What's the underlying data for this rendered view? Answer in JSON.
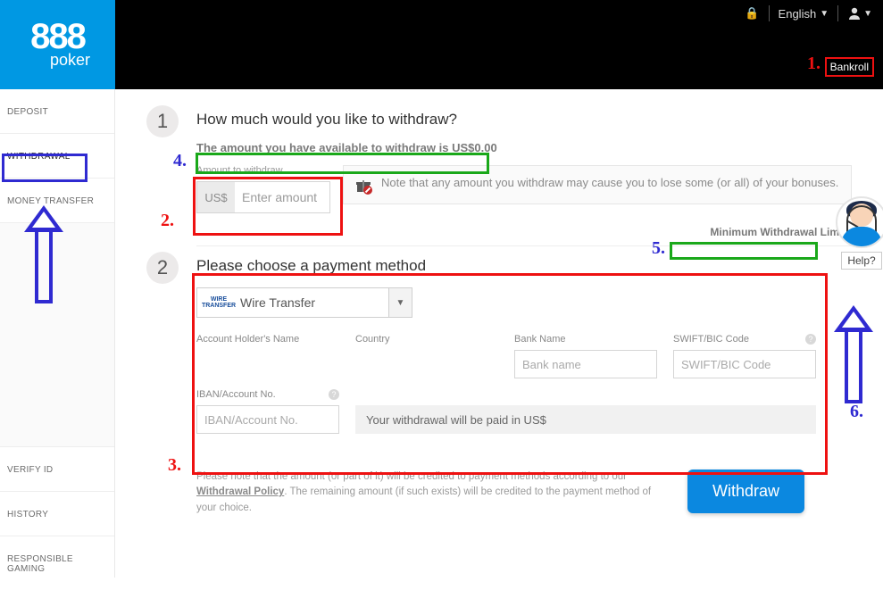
{
  "header": {
    "logo_top": "888",
    "logo_bottom": "poker",
    "language": "English",
    "bankroll_label": "Bankroll"
  },
  "sidebar": {
    "items": [
      "DEPOSIT",
      "WITHDRAWAL",
      "MONEY TRANSFER"
    ],
    "bottom_items": [
      "VERIFY ID",
      "HISTORY",
      "RESPONSIBLE GAMING"
    ],
    "active_index": 1
  },
  "step1": {
    "title": "How much would you like to withdraw?",
    "available_prefix": "The amount you have available to withdraw is ",
    "available_amount": "US$0.00",
    "amount_label": "Amount to withdraw",
    "currency_prefix": "US$",
    "amount_placeholder": "Enter amount",
    "bonus_note": "Note that any amount you withdraw may cause you to lose some (or all) of your bonuses.",
    "min_limits_link": "Minimum Withdrawal Limits"
  },
  "step2": {
    "title": "Please choose a payment method",
    "method_selected": "Wire Transfer",
    "method_icon_text": "WIRE\nTRANSFER",
    "fields": {
      "holder_label": "Account Holder's Name",
      "country_label": "Country",
      "bank_label": "Bank Name",
      "bank_placeholder": "Bank name",
      "swift_label": "SWIFT/BIC Code",
      "swift_placeholder": "SWIFT/BIC Code",
      "iban_label": "IBAN/Account No.",
      "iban_placeholder": "IBAN/Account No."
    },
    "paid_note": "Your withdrawal will be paid in US$"
  },
  "footer": {
    "text_a": "Please note that the amount (or part of it) will be credited to payment methods according to our ",
    "policy_link": "Withdrawal Policy",
    "text_b": ". The remaining amount (if such exists) will be credited to the payment method of your choice.",
    "button": "Withdraw"
  },
  "help": {
    "label": "Help?"
  },
  "annotations": {
    "n1": "1.",
    "n2": "2.",
    "n3": "3.",
    "n4": "4.",
    "n5": "5.",
    "n6": "6."
  },
  "colors": {
    "brand": "#0098e3",
    "annot_red": "#e11",
    "annot_blue": "#2f2ad1",
    "annot_green": "#1aa81a"
  }
}
